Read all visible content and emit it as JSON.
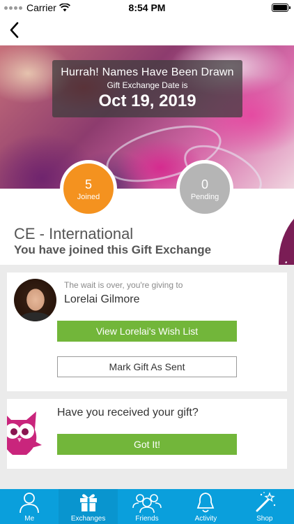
{
  "status_bar": {
    "carrier": "Carrier",
    "time": "8:54 PM"
  },
  "hero": {
    "headline": "Hurrah! Names Have Been Drawn",
    "date_label": "Gift Exchange Date is",
    "date": "Oct 19, 2019"
  },
  "stats": {
    "joined_count": "5",
    "joined_label": "Joined",
    "pending_count": "0",
    "pending_label": "Pending"
  },
  "exchange": {
    "name": "CE - International",
    "status": "You have joined this Gift Exchange",
    "decor_glyph": "i"
  },
  "recipient": {
    "intro": "The wait is over, you're giving to",
    "name": "Lorelai Gilmore",
    "wishlist_button": "View Lorelai's Wish List",
    "mark_sent_button": "Mark Gift As Sent"
  },
  "received": {
    "question": "Have you received your gift?",
    "got_it_button": "Got It!"
  },
  "tabs": [
    {
      "label": "Me",
      "icon": "person-icon"
    },
    {
      "label": "Exchanges",
      "icon": "gift-icon"
    },
    {
      "label": "Friends",
      "icon": "friends-icon"
    },
    {
      "label": "Activity",
      "icon": "bell-icon"
    },
    {
      "label": "Shop",
      "icon": "magic-wand-icon"
    }
  ],
  "colors": {
    "accent_green": "#72b63a",
    "joined_orange": "#f4921f",
    "pending_gray": "#b5b5b5",
    "tab_blue": "#0a9fdc",
    "brand_purple": "#7a1d55"
  }
}
